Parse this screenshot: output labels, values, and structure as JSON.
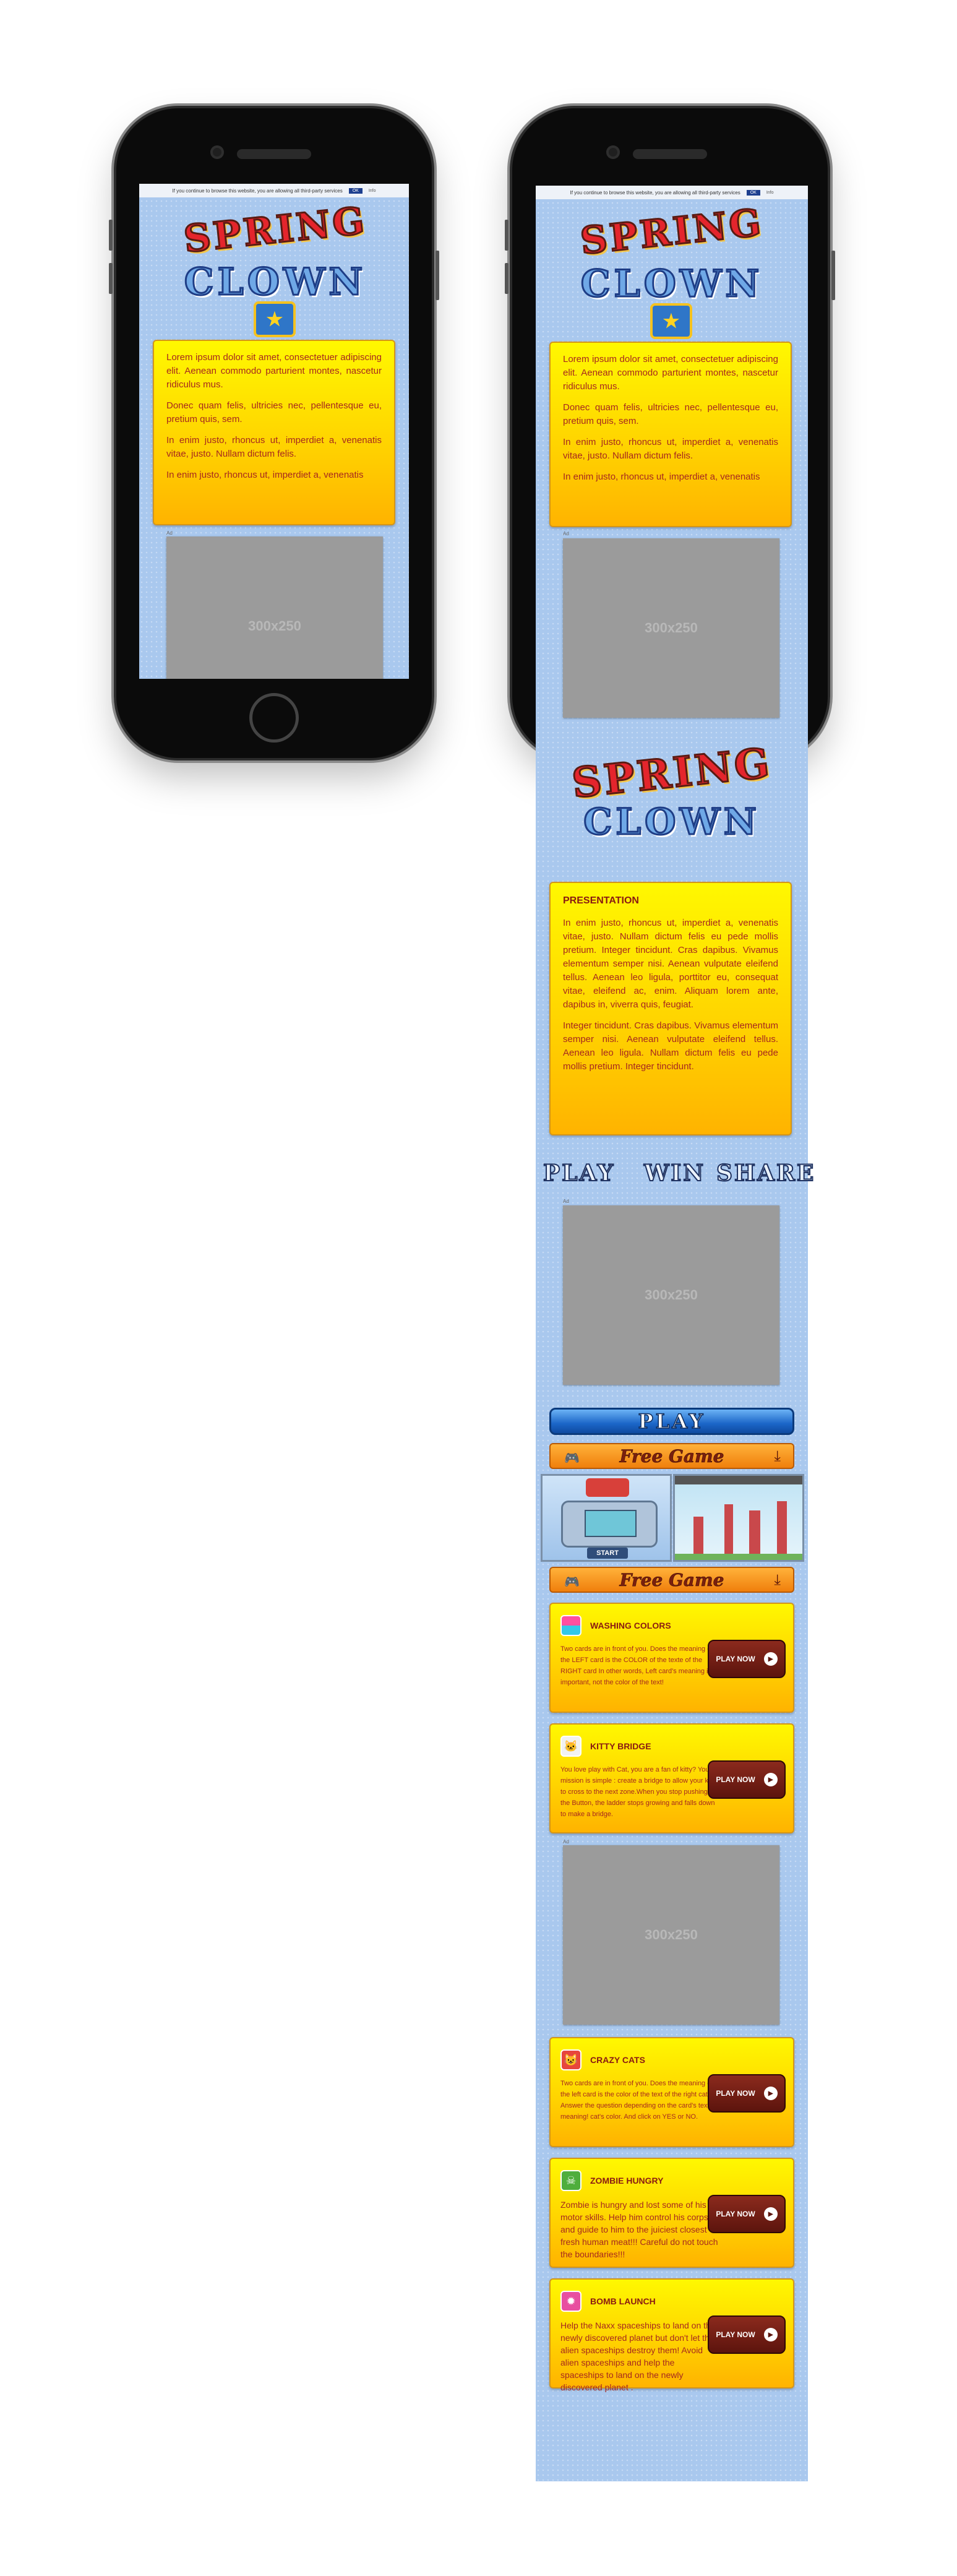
{
  "cookie_bar": {
    "text": "If you continue to browse this website, you are allowing all third-party services",
    "ok": "OK",
    "more": "Info"
  },
  "logo": {
    "top": "SPRING",
    "bottom": "CLOWN"
  },
  "intro": {
    "p1": "Lorem ipsum dolor sit amet, consectetuer adipiscing elit. Aenean commodo parturient montes, nascetur ridiculus mus.",
    "p2": "Donec quam felis, ultricies nec, pellentesque eu, pretium quis, sem.",
    "p3": "In enim justo, rhoncus ut, imperdiet a, venenatis vitae, justo. Nullam dictum felis.",
    "p4": "In enim justo, rhoncus ut, imperdiet a, venenatis"
  },
  "ad": {
    "label": "300x250",
    "small_label": "Ad"
  },
  "presentation": {
    "title": "PRESENTATION",
    "p1": "In enim justo, rhoncus ut, imperdiet a, venenatis vitae, justo. Nullam dictum felis eu pede mollis pretium. Integer tincidunt. Cras dapibus. Vivamus elementum semper nisi. Aenean vulputate eleifend tellus. Aenean leo ligula, porttitor eu, consequat vitae, eleifend ac, enim. Aliquam lorem ante, dapibus in, viverra quis, feugiat.",
    "p2": "Integer tincidunt. Cras dapibus. Vivamus elementum semper nisi. Aenean vulputate eleifend tellus. Aenean leo ligula. Nullam dictum felis eu pede mollis pretium. Integer tincidunt."
  },
  "pws": {
    "play": "PLAY",
    "win": "WIN",
    "share": "SHARE"
  },
  "play_button": "PLAY",
  "free_game": "Free Game",
  "thumb": {
    "start": "START"
  },
  "games": [
    {
      "name": "WASHING COLORS",
      "desc": "Two cards are in front of you. Does the meaning of the LEFT card is the COLOR of the texte of the RIGHT card In other words, Left card's meaning is important, not the color of the text!",
      "cta": "PLAY NOW",
      "icon": "washing-icon"
    },
    {
      "name": "KITTY BRIDGE",
      "desc": "You love play with Cat, you are a fan of kitty? Your mission is simple : create a bridge to allow your kitty to cross to the next zone.When you stop pushing the Button, the ladder stops growing and falls down to make a bridge.",
      "cta": "PLAY NOW",
      "icon": "kitty-icon"
    },
    {
      "name": "CRAZY CATS",
      "desc": "Two cards are in front of you. Does the meaning of the left card is the color of the text of the right cat ? Answer the question depending on the card's text meaning! cat's color. And click on YES or NO.",
      "cta": "PLAY NOW",
      "icon": "cat-icon"
    },
    {
      "name": "ZOMBIE HUNGRY",
      "desc": "Zombie is hungry and lost some of his motor skills. Help him control his corpse and guide to him to the juiciest closest fresh human meat!!! Careful do not touch the boundaries!!!",
      "cta": "PLAY NOW",
      "icon": "zombie-icon"
    },
    {
      "name": "BOMB LAUNCH",
      "desc": "Help the Naxx spaceships to land on the newly discovered planet but don't let the alien spaceships destroy them! Avoid alien spaceships and help the spaceships to land on the newly discovered planet .",
      "cta": "PLAY NOW",
      "icon": "bomb-icon"
    }
  ],
  "colors": {
    "page_bg": "#a9c8ee",
    "card_top": "#fff800",
    "card_bottom": "#ffb300",
    "text_red": "#a6281f",
    "button_dark_red": "#5c140d",
    "play_blue": "#1b66c8",
    "free_orange": "#f07f0c"
  }
}
